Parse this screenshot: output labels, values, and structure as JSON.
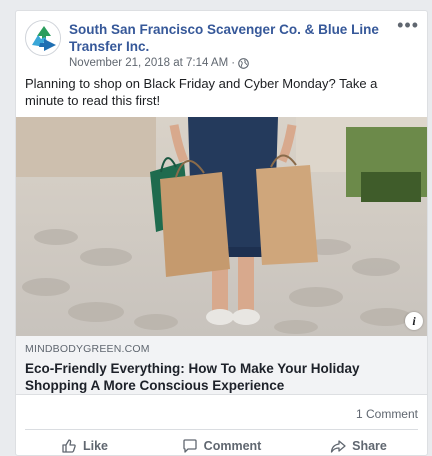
{
  "post": {
    "page_name": "South San Francisco Scavenger Co. & Blue Line Transfer Inc.",
    "timestamp": "November 21, 2018 at 7:14 AM",
    "meta_separator": "·",
    "privacy_icon": "globe-icon",
    "more_label": "•••",
    "text": "Planning to shop on Black Friday and Cyber Monday? Take a minute to read this first!"
  },
  "link_preview": {
    "domain": "MINDBODYGREEN.COM",
    "title": "Eco-Friendly Everything: How To Make Your Holiday Shopping A More Conscious Experience",
    "info_label": "i"
  },
  "engagement": {
    "comment_count": "1 Comment"
  },
  "actions": {
    "like": "Like",
    "comment": "Comment",
    "share": "Share"
  },
  "colors": {
    "link_blue": "#365899",
    "secondary_text": "#606770",
    "link_box_bg": "#f2f3f5"
  }
}
